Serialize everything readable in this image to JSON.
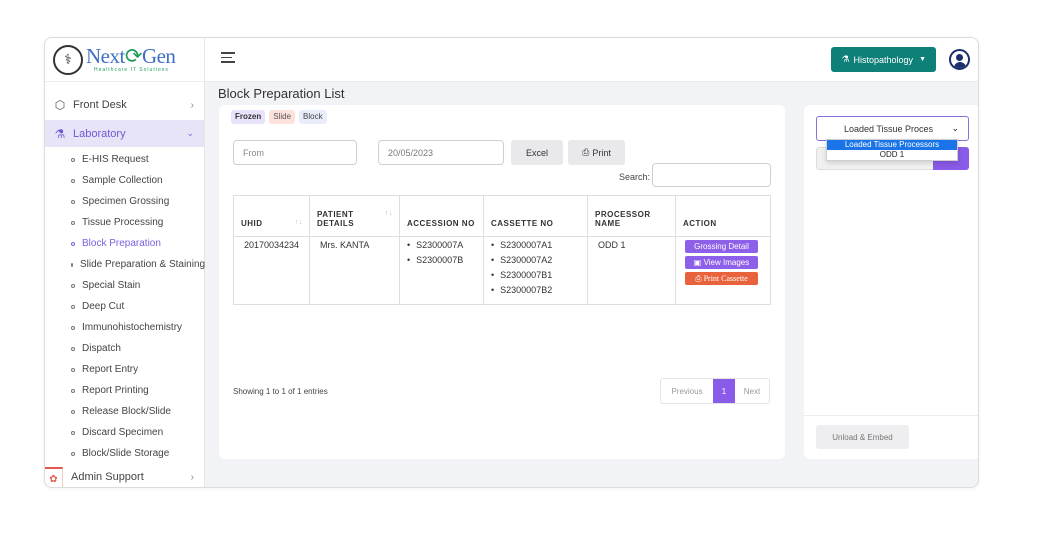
{
  "brand": {
    "name_part1": "Next",
    "name_part2": "Gen",
    "tagline": "Healthcare IT Solutions"
  },
  "sidebar": {
    "front_desk": "Front Desk",
    "laboratory": "Laboratory",
    "items": [
      "E-HIS Request",
      "Sample Collection",
      "Specimen Grossing",
      "Tissue Processing",
      "Block Preparation",
      "Slide Preparation & Staining",
      "Special Stain",
      "Deep Cut",
      "Immunohistochemistry",
      "Dispatch",
      "Report Entry",
      "Report Printing",
      "Release Block/Slide",
      "Discard Specimen",
      "Block/Slide Storage"
    ],
    "active_item": "Block Preparation",
    "admin_support": "Admin Support"
  },
  "header": {
    "department": "Histopathology"
  },
  "page": {
    "title": "Block Preparation List",
    "tags": [
      "Frozen",
      "Slide",
      "Block"
    ]
  },
  "filters": {
    "from_placeholder": "From",
    "to_date": "20/05/2023",
    "excel_label": "Excel",
    "print_label": "Print",
    "search_label": "Search:"
  },
  "table": {
    "headers": {
      "uhid": "UHID",
      "patient_details": "PATIENT DETAILS",
      "accession_no": "ACCESSION NO",
      "cassette_no": "CASSETTE NO",
      "processor_name": "PROCESSOR NAME",
      "action": "ACTION"
    },
    "rows": [
      {
        "uhid": "20170034234",
        "patient": "Mrs. KANTA",
        "accession": [
          "S2300007A",
          "S2300007B"
        ],
        "cassettes": [
          "S2300007A1",
          "S2300007A2",
          "S2300007B1",
          "S2300007B2"
        ],
        "processor": "ODD 1",
        "actions": {
          "grossing": "Grossing Detail",
          "images": "View Images",
          "print_cassette": "Print Cassette"
        }
      }
    ]
  },
  "pagination": {
    "info": "Showing 1 to 1 of 1 entries",
    "previous": "Previous",
    "current": "1",
    "next": "Next"
  },
  "right_panel": {
    "select_value": "Loaded Tissue Proces",
    "options": [
      "Loaded Tissue Processors",
      "ODD 1"
    ],
    "selected_option": "Loaded Tissue Processors",
    "unload_label": "Unload & Embed"
  },
  "colors": {
    "accent_purple": "#8a5ae8",
    "teal": "#0f8077",
    "orange": "#e8633b"
  }
}
